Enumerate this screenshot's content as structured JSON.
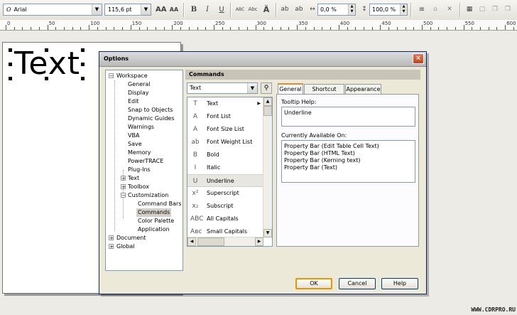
{
  "propbar": {
    "font_name": "Arial",
    "font_size": "115,6 pt",
    "grow_icon": "AA",
    "shrink_icon": "AA",
    "bold_icon": "B",
    "italic_icon": "I",
    "underline_icon": "U",
    "smallcaps_label": "ABC",
    "allcaps_label": "Abc",
    "char_spacing": "0,0 %",
    "line_spacing": "100,0 %"
  },
  "ruler": {
    "labels": [
      "0",
      "50",
      "100",
      "150",
      "200",
      "250",
      "300",
      "350",
      "400",
      "450",
      "500",
      "550",
      "600"
    ]
  },
  "canvas": {
    "text": "Text"
  },
  "dialog": {
    "title": "Options",
    "close_glyph": "✕",
    "tree": {
      "workspace": "Workspace",
      "general": "General",
      "display": "Display",
      "edit": "Edit",
      "snap": "Snap to Objects",
      "dynamic": "Dynamic Guides",
      "warnings": "Warnings",
      "vba": "VBA",
      "save": "Save",
      "memory": "Memory",
      "powertrace": "PowerTRACE",
      "plugins": "Plug-Ins",
      "text": "Text",
      "toolbox": "Toolbox",
      "customization": "Customization",
      "commandbars": "Command Bars",
      "commands": "Commands",
      "colorpalette": "Color Palette",
      "application": "Application",
      "document": "Document",
      "global": "Global"
    },
    "section_title": "Commands",
    "category": "Text",
    "commands": [
      {
        "label": "Text",
        "icon": "T",
        "submenu": true
      },
      {
        "label": "Font List",
        "icon": "A"
      },
      {
        "label": "Font Size List",
        "icon": "A"
      },
      {
        "label": "Font Weight List",
        "icon": "ab"
      },
      {
        "label": "Bold",
        "icon": "B"
      },
      {
        "label": "Italic",
        "icon": "I"
      },
      {
        "label": "Underline",
        "icon": "U"
      },
      {
        "label": "Superscript",
        "icon": "x²"
      },
      {
        "label": "Subscript",
        "icon": "x₂"
      },
      {
        "label": "All Capitals",
        "icon": "ABC"
      },
      {
        "label": "Small Capitals",
        "icon": "Aʙᴄ"
      }
    ],
    "tabs": [
      "General",
      "Shortcut Keys",
      "Appearance"
    ],
    "tooltip_label": "Tooltip Help:",
    "tooltip_value": "Underline",
    "available_label": "Currently Available On:",
    "available_items": [
      "Property Bar (Edit Table Cell Text)",
      "Property Bar (HTML Text)",
      "Property Bar (Kerning text)",
      "Property Bar (Text)"
    ],
    "buttons": {
      "ok": "OK",
      "cancel": "Cancel",
      "help": "Help"
    }
  },
  "watermark": "WWW.CDRPRO.RU"
}
